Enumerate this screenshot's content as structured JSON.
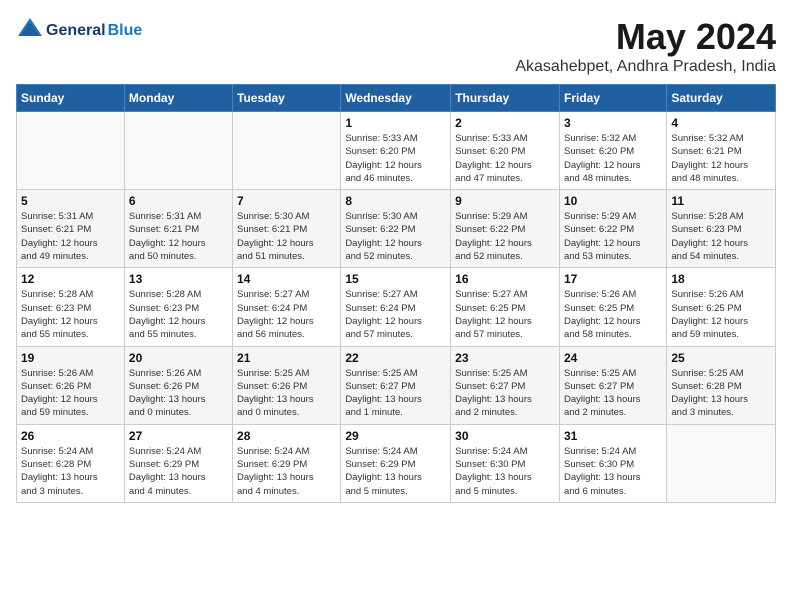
{
  "header": {
    "logo_general": "General",
    "logo_blue": "Blue",
    "month": "May 2024",
    "location": "Akasahebpet, Andhra Pradesh, India"
  },
  "days_of_week": [
    "Sunday",
    "Monday",
    "Tuesday",
    "Wednesday",
    "Thursday",
    "Friday",
    "Saturday"
  ],
  "weeks": [
    [
      {
        "day": "",
        "info": ""
      },
      {
        "day": "",
        "info": ""
      },
      {
        "day": "",
        "info": ""
      },
      {
        "day": "1",
        "info": "Sunrise: 5:33 AM\nSunset: 6:20 PM\nDaylight: 12 hours\nand 46 minutes."
      },
      {
        "day": "2",
        "info": "Sunrise: 5:33 AM\nSunset: 6:20 PM\nDaylight: 12 hours\nand 47 minutes."
      },
      {
        "day": "3",
        "info": "Sunrise: 5:32 AM\nSunset: 6:20 PM\nDaylight: 12 hours\nand 48 minutes."
      },
      {
        "day": "4",
        "info": "Sunrise: 5:32 AM\nSunset: 6:21 PM\nDaylight: 12 hours\nand 48 minutes."
      }
    ],
    [
      {
        "day": "5",
        "info": "Sunrise: 5:31 AM\nSunset: 6:21 PM\nDaylight: 12 hours\nand 49 minutes."
      },
      {
        "day": "6",
        "info": "Sunrise: 5:31 AM\nSunset: 6:21 PM\nDaylight: 12 hours\nand 50 minutes."
      },
      {
        "day": "7",
        "info": "Sunrise: 5:30 AM\nSunset: 6:21 PM\nDaylight: 12 hours\nand 51 minutes."
      },
      {
        "day": "8",
        "info": "Sunrise: 5:30 AM\nSunset: 6:22 PM\nDaylight: 12 hours\nand 52 minutes."
      },
      {
        "day": "9",
        "info": "Sunrise: 5:29 AM\nSunset: 6:22 PM\nDaylight: 12 hours\nand 52 minutes."
      },
      {
        "day": "10",
        "info": "Sunrise: 5:29 AM\nSunset: 6:22 PM\nDaylight: 12 hours\nand 53 minutes."
      },
      {
        "day": "11",
        "info": "Sunrise: 5:28 AM\nSunset: 6:23 PM\nDaylight: 12 hours\nand 54 minutes."
      }
    ],
    [
      {
        "day": "12",
        "info": "Sunrise: 5:28 AM\nSunset: 6:23 PM\nDaylight: 12 hours\nand 55 minutes."
      },
      {
        "day": "13",
        "info": "Sunrise: 5:28 AM\nSunset: 6:23 PM\nDaylight: 12 hours\nand 55 minutes."
      },
      {
        "day": "14",
        "info": "Sunrise: 5:27 AM\nSunset: 6:24 PM\nDaylight: 12 hours\nand 56 minutes."
      },
      {
        "day": "15",
        "info": "Sunrise: 5:27 AM\nSunset: 6:24 PM\nDaylight: 12 hours\nand 57 minutes."
      },
      {
        "day": "16",
        "info": "Sunrise: 5:27 AM\nSunset: 6:25 PM\nDaylight: 12 hours\nand 57 minutes."
      },
      {
        "day": "17",
        "info": "Sunrise: 5:26 AM\nSunset: 6:25 PM\nDaylight: 12 hours\nand 58 minutes."
      },
      {
        "day": "18",
        "info": "Sunrise: 5:26 AM\nSunset: 6:25 PM\nDaylight: 12 hours\nand 59 minutes."
      }
    ],
    [
      {
        "day": "19",
        "info": "Sunrise: 5:26 AM\nSunset: 6:26 PM\nDaylight: 12 hours\nand 59 minutes."
      },
      {
        "day": "20",
        "info": "Sunrise: 5:26 AM\nSunset: 6:26 PM\nDaylight: 13 hours\nand 0 minutes."
      },
      {
        "day": "21",
        "info": "Sunrise: 5:25 AM\nSunset: 6:26 PM\nDaylight: 13 hours\nand 0 minutes."
      },
      {
        "day": "22",
        "info": "Sunrise: 5:25 AM\nSunset: 6:27 PM\nDaylight: 13 hours\nand 1 minute."
      },
      {
        "day": "23",
        "info": "Sunrise: 5:25 AM\nSunset: 6:27 PM\nDaylight: 13 hours\nand 2 minutes."
      },
      {
        "day": "24",
        "info": "Sunrise: 5:25 AM\nSunset: 6:27 PM\nDaylight: 13 hours\nand 2 minutes."
      },
      {
        "day": "25",
        "info": "Sunrise: 5:25 AM\nSunset: 6:28 PM\nDaylight: 13 hours\nand 3 minutes."
      }
    ],
    [
      {
        "day": "26",
        "info": "Sunrise: 5:24 AM\nSunset: 6:28 PM\nDaylight: 13 hours\nand 3 minutes."
      },
      {
        "day": "27",
        "info": "Sunrise: 5:24 AM\nSunset: 6:29 PM\nDaylight: 13 hours\nand 4 minutes."
      },
      {
        "day": "28",
        "info": "Sunrise: 5:24 AM\nSunset: 6:29 PM\nDaylight: 13 hours\nand 4 minutes."
      },
      {
        "day": "29",
        "info": "Sunrise: 5:24 AM\nSunset: 6:29 PM\nDaylight: 13 hours\nand 5 minutes."
      },
      {
        "day": "30",
        "info": "Sunrise: 5:24 AM\nSunset: 6:30 PM\nDaylight: 13 hours\nand 5 minutes."
      },
      {
        "day": "31",
        "info": "Sunrise: 5:24 AM\nSunset: 6:30 PM\nDaylight: 13 hours\nand 6 minutes."
      },
      {
        "day": "",
        "info": ""
      }
    ]
  ]
}
